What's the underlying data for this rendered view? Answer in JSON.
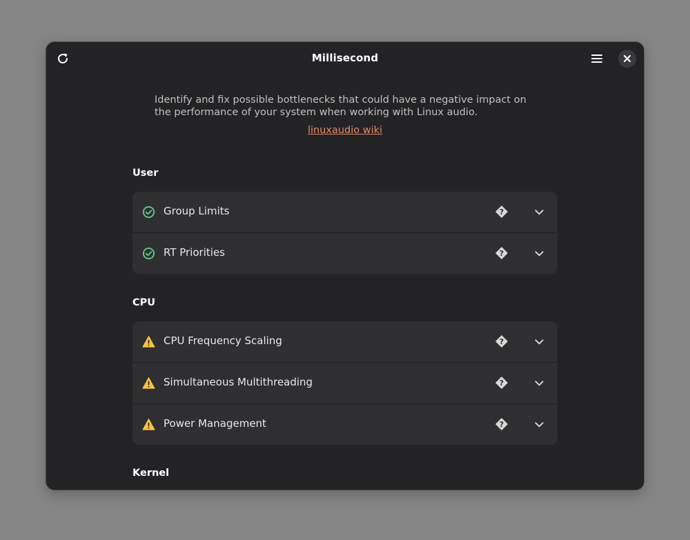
{
  "window": {
    "title": "Millisecond"
  },
  "headerbar": {
    "refresh_icon": "refresh-icon",
    "menu_icon": "hamburger-menu-icon",
    "close_icon": "close-icon"
  },
  "intro": {
    "text": "Identify and fix possible bottlenecks that could have a negative impact on the performance of your system when working with Linux audio.",
    "link": "linuxaudio wiki"
  },
  "colors": {
    "ok": "#5fc98b",
    "warning": "#f6c344",
    "link": "#e0876a"
  },
  "sections": [
    {
      "title": "User",
      "items": [
        {
          "label": "Group Limits",
          "status": "ok"
        },
        {
          "label": "RT Priorities",
          "status": "ok"
        }
      ]
    },
    {
      "title": "CPU",
      "items": [
        {
          "label": "CPU Frequency Scaling",
          "status": "warning"
        },
        {
          "label": "Simultaneous Multithreading",
          "status": "warning"
        },
        {
          "label": "Power Management",
          "status": "warning"
        }
      ]
    },
    {
      "title": "Kernel",
      "items": []
    }
  ]
}
